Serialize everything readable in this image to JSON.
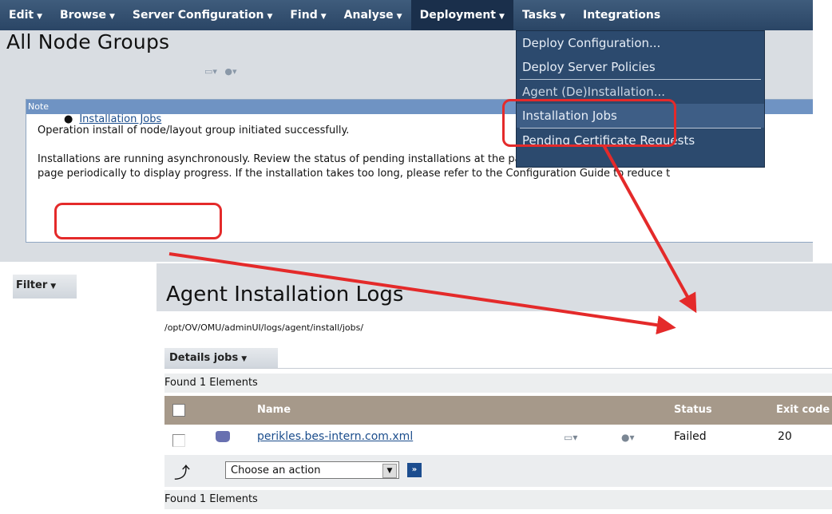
{
  "menubar": {
    "items": [
      {
        "label": "Edit"
      },
      {
        "label": "Browse"
      },
      {
        "label": "Server Configuration"
      },
      {
        "label": "Find"
      },
      {
        "label": "Analyse"
      },
      {
        "label": "Deployment"
      },
      {
        "label": "Tasks"
      },
      {
        "label": "Integrations"
      }
    ]
  },
  "deployment_menu": {
    "items": [
      {
        "label": "Deploy Configuration..."
      },
      {
        "label": "Deploy Server Policies"
      },
      {
        "label": "Agent (De)Installation..."
      },
      {
        "label": "Installation Jobs"
      },
      {
        "label": "Pending Certificate Requests"
      }
    ]
  },
  "page": {
    "title": "All Node Groups"
  },
  "note": {
    "header": "Note",
    "line1": "Operation install of node/layout group initiated successfully.",
    "line2": "Installations are running asynchronously. Review the status of pending installations at the page below. Initially the pag",
    "line3": "page periodically to display progress. If the installation takes too long, please refer to the Configuration Guide to reduce t",
    "link": "Installation Jobs"
  },
  "filter": {
    "label": "Filter"
  },
  "logs": {
    "title": "Agent Installation Logs",
    "path": "/opt/OV/OMU/adminUI/logs/agent/install/jobs/",
    "details_label": "Details jobs",
    "found_top": "Found 1 Elements",
    "found_bottom": "Found 1 Elements",
    "columns": [
      "Name",
      "Status",
      "Exit code"
    ],
    "rows": [
      {
        "name": "perikles.bes-intern.com.xml",
        "status": "Failed",
        "exit_code": "20"
      }
    ],
    "action_placeholder": "Choose an action",
    "go_label": "»"
  },
  "colors": {
    "menubar": "#2a4565",
    "annotation_red": "#e42a2a"
  }
}
